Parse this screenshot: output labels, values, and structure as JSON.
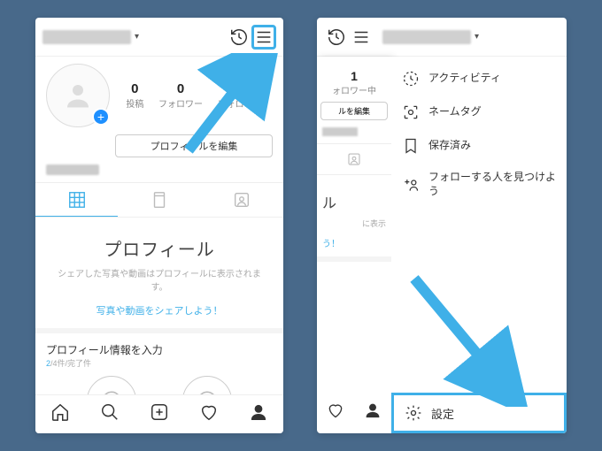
{
  "left": {
    "username_dropdown": "▾",
    "stats": {
      "posts_n": "0",
      "posts_l": "投稿",
      "followers_n": "0",
      "followers_l": "フォロワー",
      "following_n": "0",
      "following_l": "フォロー中"
    },
    "edit_profile": "プロフィールを編集",
    "empty": {
      "title": "プロフィール",
      "sub": "シェアした写真や動画はプロフィールに表示されます。",
      "cta": "写真や動画をシェアしよう！"
    },
    "info": {
      "title": "プロフィール情報を入力",
      "done": "2",
      "sep": "/4件",
      "tail": "/完了件"
    }
  },
  "right": {
    "peek": {
      "followers_n": "1",
      "followers_l": "ォロワー中",
      "edit": "ルを編集",
      "title": "ル",
      "sub": "に表示",
      "cta": "う！"
    },
    "menu": {
      "activity": "アクティビティ",
      "nametag": "ネームタグ",
      "saved": "保存済み",
      "discover": "フォローする人を見つけよう",
      "settings": "設定"
    }
  }
}
